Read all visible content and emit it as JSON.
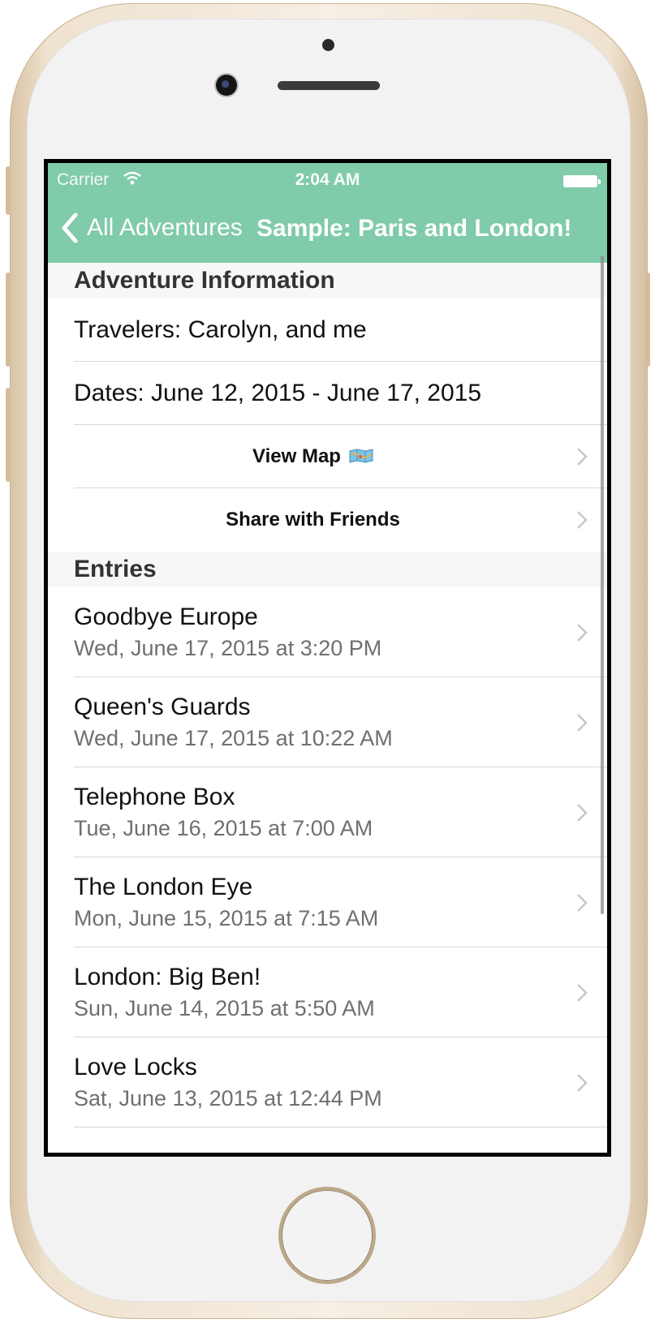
{
  "status_bar": {
    "carrier": "Carrier",
    "time": "2:04 AM"
  },
  "nav_bar": {
    "back_label": "All Adventures",
    "title": "Sample: Paris and London!",
    "color": "#80cba9"
  },
  "sections": {
    "info": {
      "header": "Adventure Information",
      "travelers": "Travelers: Carolyn, and me",
      "dates": "Dates: June 12, 2015 - June 17, 2015",
      "view_map": "View Map",
      "view_map_icon": "map-icon",
      "share": "Share with Friends"
    },
    "entries": {
      "header": "Entries",
      "items": [
        {
          "title": "Goodbye Europe",
          "date": "Wed, June 17, 2015 at 3:20 PM"
        },
        {
          "title": "Queen's Guards",
          "date": "Wed, June 17, 2015 at 10:22 AM"
        },
        {
          "title": "Telephone Box",
          "date": "Tue, June 16, 2015 at 7:00 AM"
        },
        {
          "title": "The London Eye",
          "date": "Mon, June 15, 2015 at 7:15 AM"
        },
        {
          "title": "London: Big Ben!",
          "date": "Sun, June 14, 2015 at 5:50 AM"
        },
        {
          "title": "Love Locks",
          "date": "Sat, June 13, 2015 at 12:44 PM"
        }
      ]
    }
  }
}
